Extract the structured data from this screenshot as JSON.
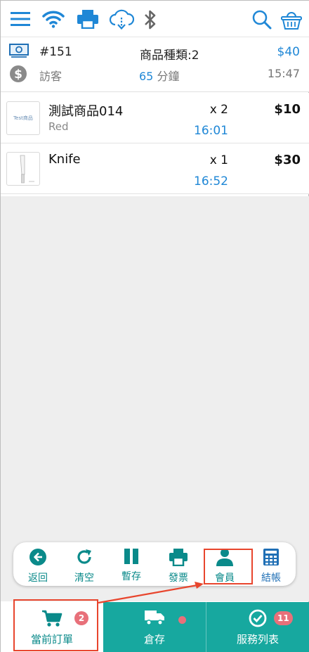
{
  "colors": {
    "accent_blue": "#1f87d6",
    "teal": "#17a89f",
    "teal_dark": "#0a8a8a",
    "badge": "#e8707a",
    "highlight": "#e8452d",
    "background_grey": "#eeeeee"
  },
  "topbar": {
    "icons": [
      "menu-icon",
      "wifi-icon",
      "printer-icon",
      "cloud-download-icon",
      "bluetooth-icon",
      "search-icon",
      "basket-icon"
    ]
  },
  "order": {
    "number": "#151",
    "product_types": "商品種類:2",
    "total": "$40",
    "customer": "訪客",
    "duration_value": "65",
    "duration_unit": "分鐘",
    "time": "15:47"
  },
  "items": [
    {
      "thumb_text": "Test商品",
      "name": "測試商品014",
      "variant": "Red",
      "qty": "x 2",
      "time": "16:01",
      "price": "$10"
    },
    {
      "thumb_text": "",
      "name": "Knife",
      "variant": "",
      "qty": "x 1",
      "time": "16:52",
      "price": "$30"
    }
  ],
  "actions": {
    "back": "返回",
    "clear": "清空",
    "hold": "暫存",
    "invoice": "發票",
    "member": "會員",
    "checkout": "結帳"
  },
  "nav": {
    "current_order": {
      "label": "當前訂單",
      "badge": "2"
    },
    "inventory": {
      "label": "倉存"
    },
    "services": {
      "label": "服務列表",
      "badge": "11"
    }
  }
}
